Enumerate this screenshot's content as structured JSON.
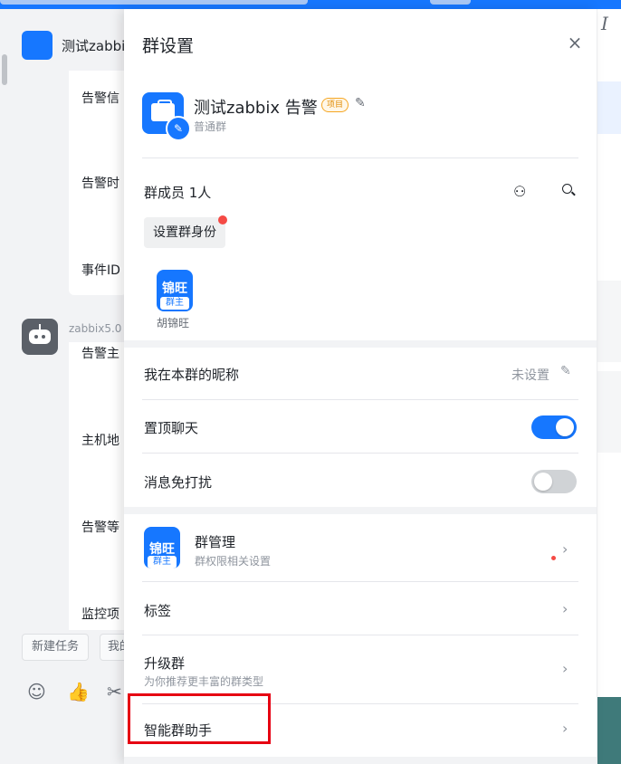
{
  "chat": {
    "title": "测试zabbi",
    "messages1": [
      "告警信",
      "告警时",
      "事件ID"
    ],
    "bot_name": "zabbix5.0",
    "messages2": [
      "告警主",
      "主机地",
      "告警等",
      "监控项"
    ],
    "chips": [
      "新建任务",
      "我的"
    ]
  },
  "toolbar_icons": [
    "smile-icon",
    "thumbs-up-icon",
    "scissors-icon"
  ],
  "panel": {
    "title": "群设置",
    "close_glyph": "×",
    "group": {
      "name": "测试zabbix 告警",
      "tag": "项目",
      "type": "普通群"
    },
    "members": {
      "label": "群成员 1人",
      "set_role_button": "设置群身份",
      "list": [
        {
          "avatar_text": "锦旺",
          "role": "群主",
          "name": "胡锦旺"
        }
      ]
    },
    "nickname": {
      "label": "我在本群的昵称",
      "value": "未设置"
    },
    "pin_chat": {
      "label": "置顶聊天",
      "on": true
    },
    "mute": {
      "label": "消息免打扰",
      "on": false
    },
    "management": {
      "avatar_text": "锦旺",
      "role": "群主",
      "title": "群管理",
      "subtitle": "群权限相关设置"
    },
    "tags": {
      "label": "标签"
    },
    "upgrade": {
      "label": "升级群",
      "subtitle": "为你推荐更丰富的群类型"
    },
    "assistant": {
      "label": "智能群助手"
    }
  },
  "colors": {
    "accent": "#1677ff",
    "highlight": "#e60012"
  }
}
